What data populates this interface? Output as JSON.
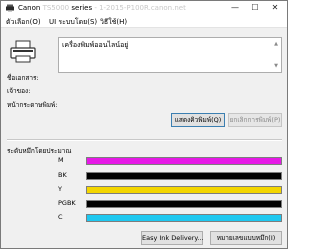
{
  "window": {
    "app_name": "Canon",
    "model_obscured": "TS5000",
    "series_label": "series",
    "serial_obscured": "- 1-2015-P100R.canon.net",
    "controls": {
      "minimize": "—",
      "maximize": "☐",
      "close": "✕"
    }
  },
  "menu": [
    {
      "label": "ตัวเลือก(O)"
    },
    {
      "label": "UI ระบบโดย(S)"
    },
    {
      "label": "วิธีใช้(H)"
    }
  ],
  "status": {
    "message": "เครื่องพิมพ์ออนไลน์อยู่"
  },
  "info_labels": {
    "document_name": "ชื่อเอกสาร:",
    "owner": "เจ้าของ:",
    "printing_page": "หน้ากระดาษพิมพ์:"
  },
  "buttons": {
    "display_queue": "แสดงคิวพิมพ์(Q)",
    "cancel_printing": "ยกเลิกการพิมพ์(P)",
    "easy_ink_delivery": "Easy Ink Delivery...",
    "ink_model_number": "หมายเลขแบบหมึก(I)"
  },
  "ink": {
    "title": "ระดับหมึกโดยประมาณ",
    "cartridges": [
      {
        "name": "M",
        "color": "#e619e6"
      },
      {
        "name": "BK",
        "color": "#000000"
      },
      {
        "name": "Y",
        "color": "#f4d600"
      },
      {
        "name": "PGBK",
        "color": "#000000"
      },
      {
        "name": "C",
        "color": "#1ec8f0"
      }
    ]
  }
}
